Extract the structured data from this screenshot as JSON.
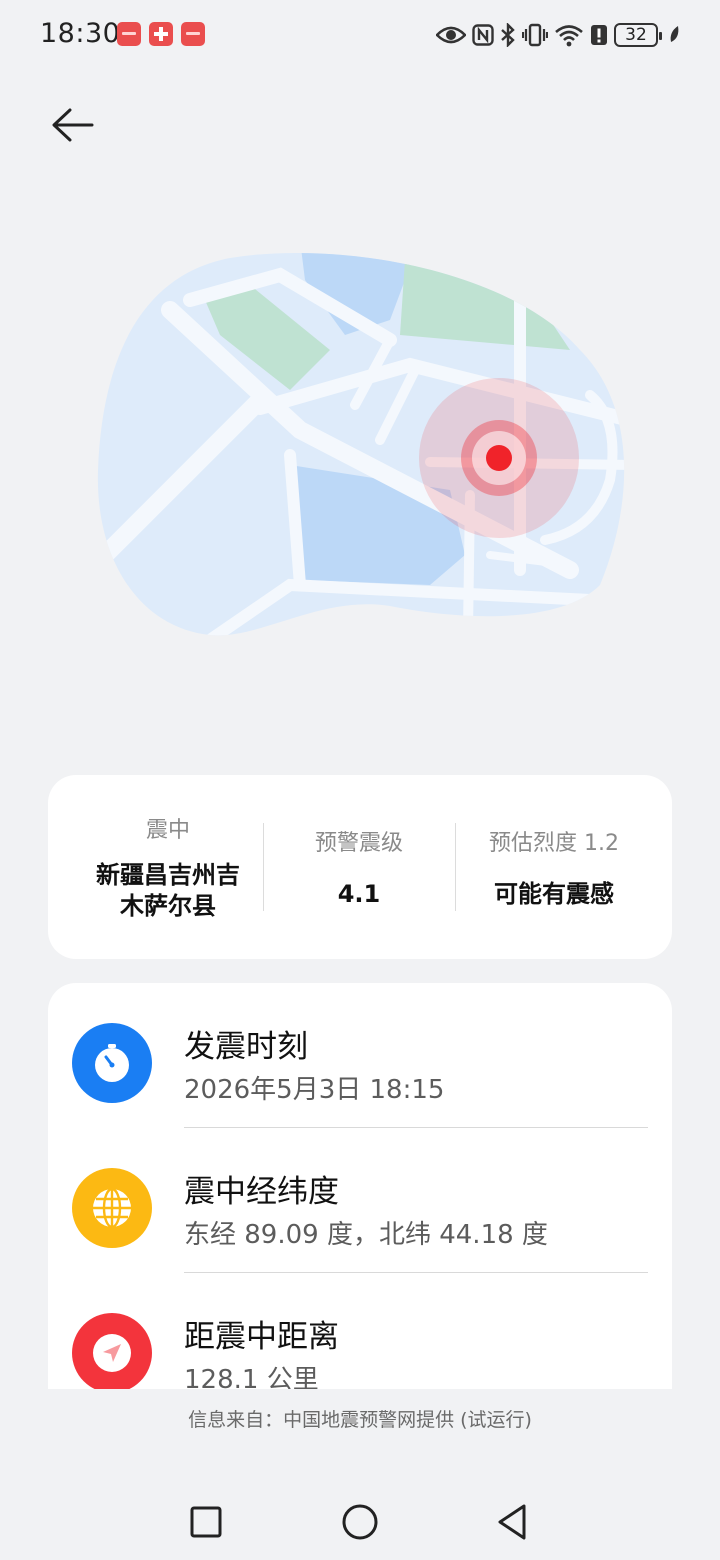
{
  "status_bar": {
    "time": "18:30",
    "notification_icons": [
      "app-notification-icon",
      "health-cross-icon",
      "app-notification-icon"
    ],
    "status_icons": [
      "eye-icon",
      "nfc-icon",
      "bluetooth-icon",
      "vibrate-icon",
      "wifi-icon",
      "alert-icon",
      "battery-icon",
      "leaf-icon"
    ],
    "battery_level": "32"
  },
  "header": {
    "back_icon": "arrow-left-icon"
  },
  "summary": {
    "epicenter_label": "震中",
    "epicenter_line1": "新疆昌吉州吉",
    "epicenter_line2": "木萨尔县",
    "magnitude_label": "预警震级",
    "magnitude_value": "4.1",
    "intensity_label": "预估烈度 1.2",
    "intensity_value": "可能有震感"
  },
  "details": [
    {
      "icon": "clock-icon",
      "color": "#1a7ef3",
      "title": "发震时刻",
      "value": "2026年5月3日 18:15"
    },
    {
      "icon": "globe-icon",
      "color": "#fcb913",
      "title": "震中经纬度",
      "value": "东经 89.09 度，北纬 44.18 度"
    },
    {
      "icon": "location-arrow-icon",
      "color": "#f3343c",
      "title": "距震中距离",
      "value": "128.1 公里"
    }
  ],
  "footer": {
    "source": "信息来自：中国地震预警网提供 (试运行)"
  },
  "nav_bar": {
    "icons": [
      "recent-apps-icon",
      "home-icon",
      "back-triangle-icon"
    ]
  },
  "colors": {
    "background": "#f1f2f4",
    "epicenter_red": "#f0232a",
    "map_water": "#bcd8f7",
    "map_land": "#deebfa",
    "map_park": "#bfe2d2"
  }
}
